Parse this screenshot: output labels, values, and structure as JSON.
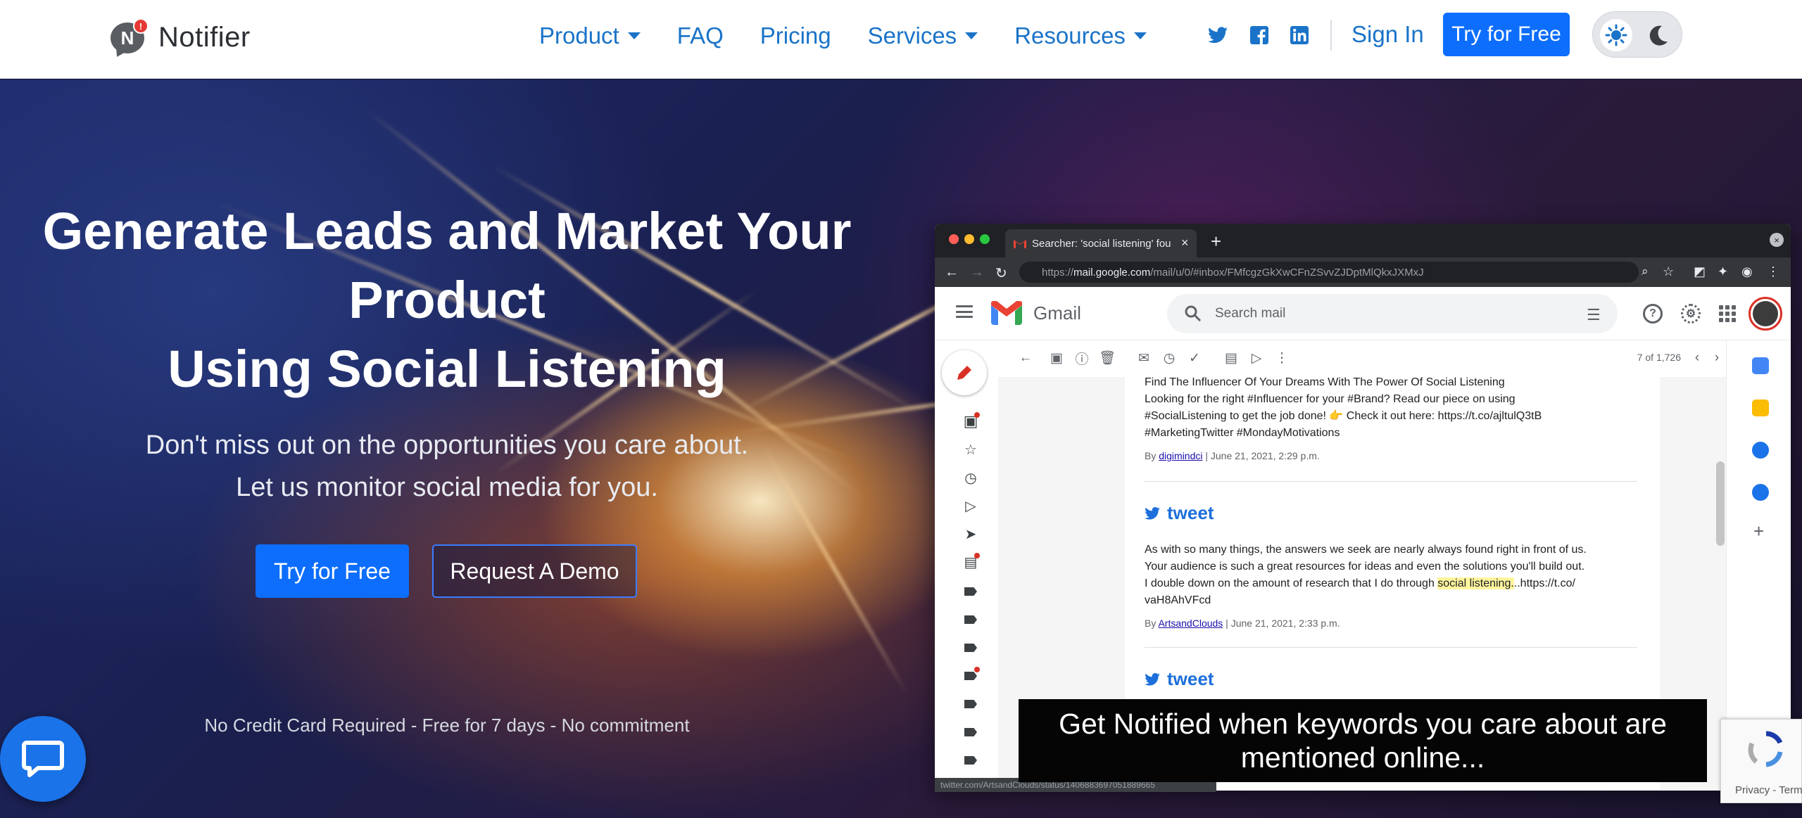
{
  "header": {
    "logo_letter": "N",
    "logo_badge": "!",
    "logo_text": "Notifier",
    "nav": [
      {
        "label": "Product",
        "dropdown": true
      },
      {
        "label": "FAQ",
        "dropdown": false
      },
      {
        "label": "Pricing",
        "dropdown": false
      },
      {
        "label": "Services",
        "dropdown": true
      },
      {
        "label": "Resources",
        "dropdown": true
      }
    ],
    "social_icons": [
      "twitter-icon",
      "facebook-icon",
      "linkedin-icon"
    ],
    "sign_in": "Sign In",
    "try_free": "Try for Free",
    "theme_icons": [
      "sun-icon",
      "moon-icon"
    ],
    "brand_color": "#0d6efd",
    "link_color": "#1a73c8"
  },
  "hero": {
    "headline_lines": [
      "Generate Leads and Market Your",
      "Product",
      "Using Social Listening"
    ],
    "sub_lines": [
      "Don't miss out on the opportunities you care about.",
      "Let us monitor social media for you."
    ],
    "primary_cta": "Try for Free",
    "secondary_cta": "Request A Demo",
    "note": "No Credit Card Required - Free for 7 days - No commitment"
  },
  "video": {
    "tab_title": "Searcher: 'social listening' fou",
    "tab_close": "×",
    "tab_plus": "+",
    "window_close": "×",
    "url_prefix": "https://",
    "url_host": "mail.google.com",
    "url_path": "/mail/u/0/#inbox/FMfcgzGkXwCFnZSvvZJDptMlQkxJXMxJ",
    "gmail_text": "Gmail",
    "search_placeholder": "Search mail",
    "pager": "7 of 1,726",
    "email_1": {
      "line_top": "Find The Influencer Of Your Dreams With The Power Of Social Listening",
      "body_1": "Looking for the right #Influencer for your #Brand? Read our piece on using",
      "body_2": "#SocialListening to get the job done!",
      "body_2b": "Check it out here: https://t.co/ajltulQ3tB",
      "body_3": "#MarketingTwitter #MondayMotivations",
      "by_prefix": "By ",
      "author": "digimindci",
      "date": " | June 21, 2021, 2:29 p.m."
    },
    "email_2": {
      "heading": "tweet",
      "line_1": "As with so many things, the answers we seek are nearly always found right in front of us.",
      "line_2": "Your audience is such a great resources for ideas and even the solutions you'll build out.",
      "line_3a": "I double down on the amount of research that I do through ",
      "line_3_hl": "social listening.",
      "line_3b": "..https://t.co/",
      "line_4": "vaH8AhVFcd",
      "by_prefix": "By ",
      "author": "ArtsandClouds",
      "date": " | June 21, 2021, 2:33 p.m."
    },
    "email_3_heading": "tweet",
    "status_url": "twitter.com/ArtsandClouds/status/1406883697051889665",
    "caption": "Get Notified when keywords you care about are mentioned online..."
  },
  "recaptcha": {
    "footer": "Privacy - Terms"
  },
  "chat": {
    "icon": "chat-bubble-icon"
  }
}
